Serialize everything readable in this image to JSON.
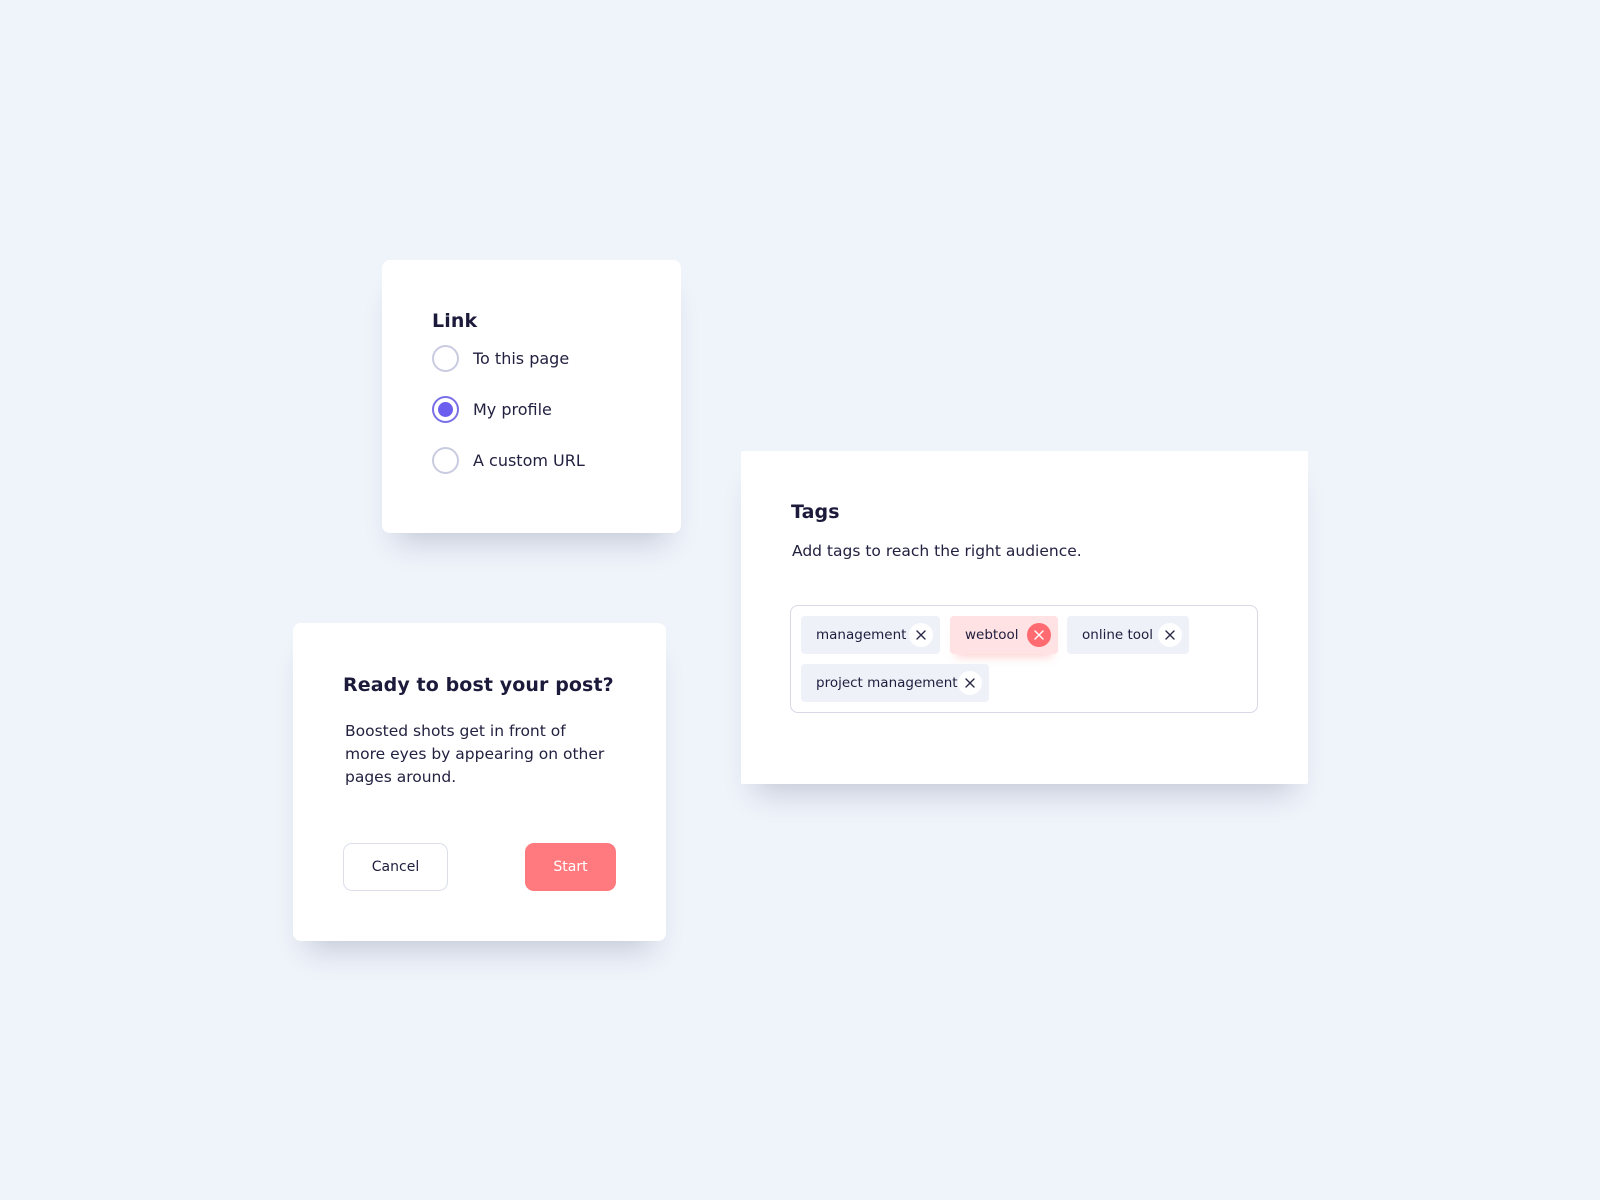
{
  "link_card": {
    "title": "Link",
    "options": [
      {
        "label": "To this page",
        "checked": false
      },
      {
        "label": "My profile",
        "checked": true
      },
      {
        "label": "A custom URL",
        "checked": false
      }
    ]
  },
  "boost_card": {
    "title": "Ready to bost your post?",
    "description": "Boosted shots get in front of more eyes by appearing on other pages around.",
    "cancel_label": "Cancel",
    "start_label": "Start"
  },
  "tags_card": {
    "title": "Tags",
    "description": "Add tags to reach the right audience.",
    "tags": [
      {
        "label": "management",
        "active": false
      },
      {
        "label": "webtool",
        "active": true
      },
      {
        "label": "online tool",
        "active": false
      },
      {
        "label": "project management",
        "active": false
      }
    ]
  },
  "colors": {
    "background": "#eff3fa",
    "accent_purple": "#6c5ff0",
    "accent_coral": "#ff7a7e",
    "text_dark": "#1c1a3a"
  },
  "icons": {
    "tag_remove": "close-icon"
  }
}
